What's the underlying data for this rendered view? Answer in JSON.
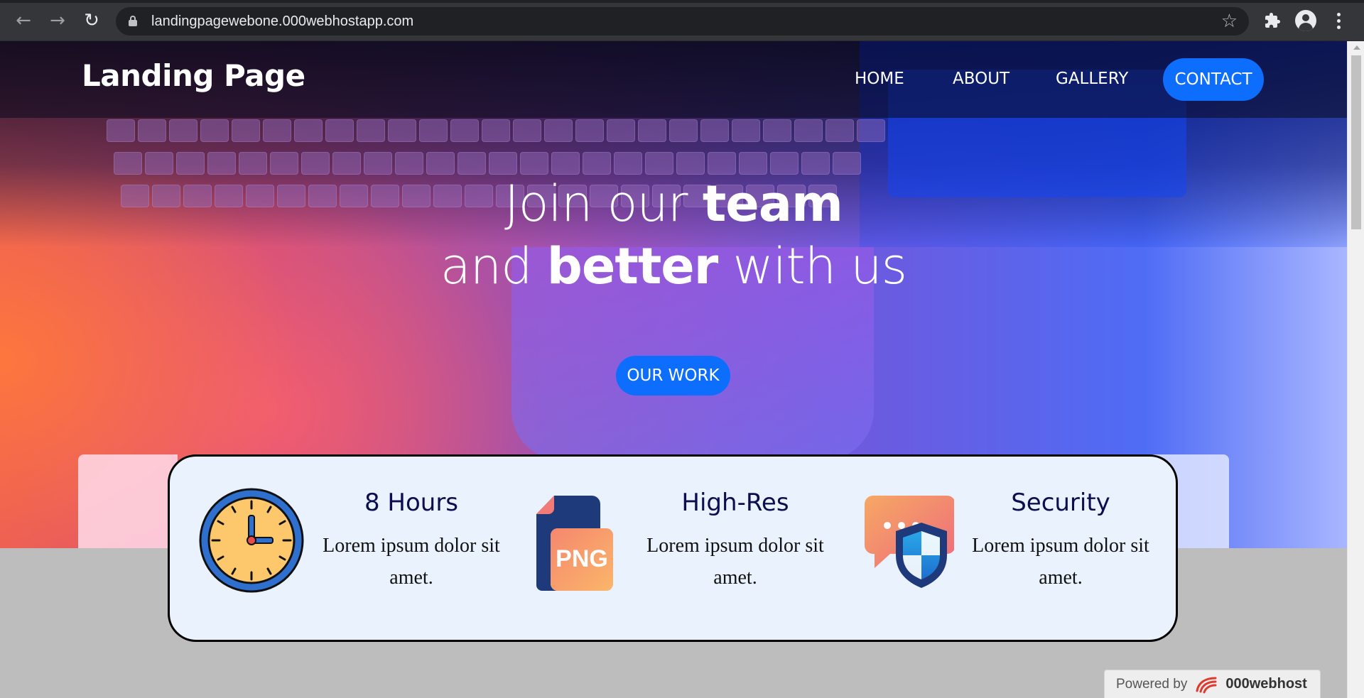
{
  "browser": {
    "url": "landingpagewebone.000webhostapp.com",
    "back_icon": "←",
    "forward_icon": "→",
    "reload_icon": "↻",
    "star_icon": "☆",
    "extensions_icon": "✱"
  },
  "navbar": {
    "brand": "Landing Page",
    "links": [
      "HOME",
      "ABOUT",
      "GALLERY"
    ],
    "contact": "CONTACT",
    "accent": "#0d6efd"
  },
  "hero": {
    "line1_light": "Join our ",
    "line1_bold": "team",
    "line2_light_a": "and ",
    "line2_bold": "better",
    "line2_light_b": " with us",
    "cta": "OUR WORK"
  },
  "features": [
    {
      "icon": "clock-icon",
      "title": "8 Hours",
      "desc": "Lorem ipsum dolor sit amet."
    },
    {
      "icon": "png-file-icon",
      "title": "High-Res",
      "desc": "Lorem ipsum dolor sit amet.",
      "icon_text": "PNG"
    },
    {
      "icon": "chat-shield-icon",
      "title": "Security",
      "desc": "Lorem ipsum dolor sit amet."
    }
  ],
  "footer": {
    "powered_label": "Powered by",
    "powered_name": "000webhost"
  }
}
